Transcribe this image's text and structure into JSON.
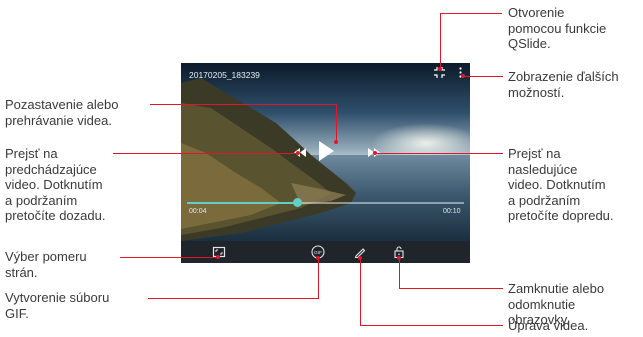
{
  "video": {
    "file_name": "20170205_183239",
    "time_current": "00:04",
    "time_total": "00:10",
    "progress_fraction": 0.4
  },
  "icons": {
    "qslide": "qslide-icon",
    "more": "more-options-icon",
    "play": "play-icon",
    "previous": "rewind-icon",
    "next": "fast-forward-icon",
    "aspect": "aspect-ratio-icon",
    "gif": "gif-icon",
    "edit": "pencil-icon",
    "lock": "unlock-icon"
  },
  "callouts": {
    "qslide": "Otvorenie\npomocou funkcie\nQSlide.",
    "more": "Zobrazenie ďalších\nmožností.",
    "pause_play": "Pozastavenie alebo\nprehrávanie videa.",
    "previous": "Prejsť na\npredchádzajúce\nvideo. Dotknutím\na podržaním\npretočíte dozadu.",
    "next": "Prejsť na\nnasledujúce\nvideo. Dotknutím\na podržaním\npretočíte dopredu.",
    "aspect": "Výber pomeru\nstrán.",
    "gif": "Vytvorenie súboru\nGIF.",
    "lock": "Zamknutie alebo\nodomknutie\nobrazovky.",
    "edit": "Úprava videa."
  },
  "colors": {
    "leader_line": "#e0162b",
    "seek_accent": "#5fd0c5"
  }
}
